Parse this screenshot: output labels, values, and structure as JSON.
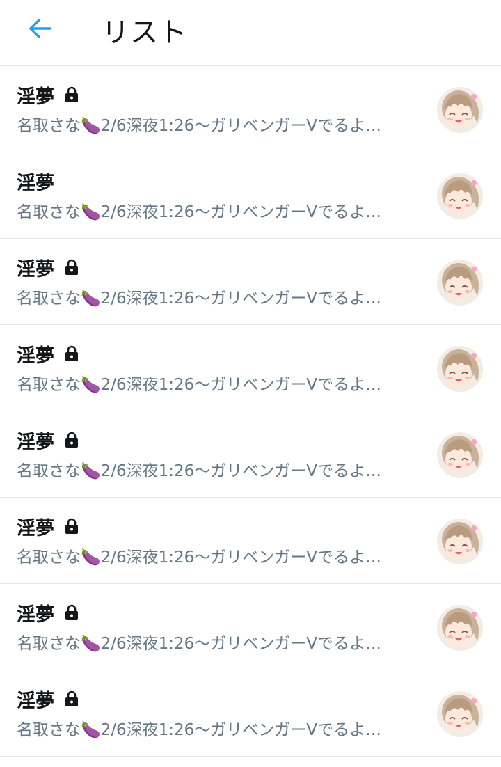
{
  "header": {
    "title": "リスト",
    "back_icon": "arrow-left-icon",
    "accent_color": "#1da1f2"
  },
  "lists": [
    {
      "name": "淫夢",
      "locked": true,
      "description": "名取さな🍆2/6深夜1:26〜ガリベンガーVでるよ…"
    },
    {
      "name": "淫夢",
      "locked": false,
      "description": "名取さな🍆2/6深夜1:26〜ガリベンガーVでるよ…"
    },
    {
      "name": "淫夢",
      "locked": true,
      "description": "名取さな🍆2/6深夜1:26〜ガリベンガーVでるよ…"
    },
    {
      "name": "淫夢",
      "locked": true,
      "description": "名取さな🍆2/6深夜1:26〜ガリベンガーVでるよ…"
    },
    {
      "name": "淫夢",
      "locked": true,
      "description": "名取さな🍆2/6深夜1:26〜ガリベンガーVでるよ…"
    },
    {
      "name": "淫夢",
      "locked": true,
      "description": "名取さな🍆2/6深夜1:26〜ガリベンガーVでるよ…"
    },
    {
      "name": "淫夢",
      "locked": true,
      "description": "名取さな🍆2/6深夜1:26〜ガリベンガーVでるよ…"
    },
    {
      "name": "淫夢",
      "locked": true,
      "description": "名取さな🍆2/6深夜1:26〜ガリベンガーVでるよ…"
    }
  ]
}
